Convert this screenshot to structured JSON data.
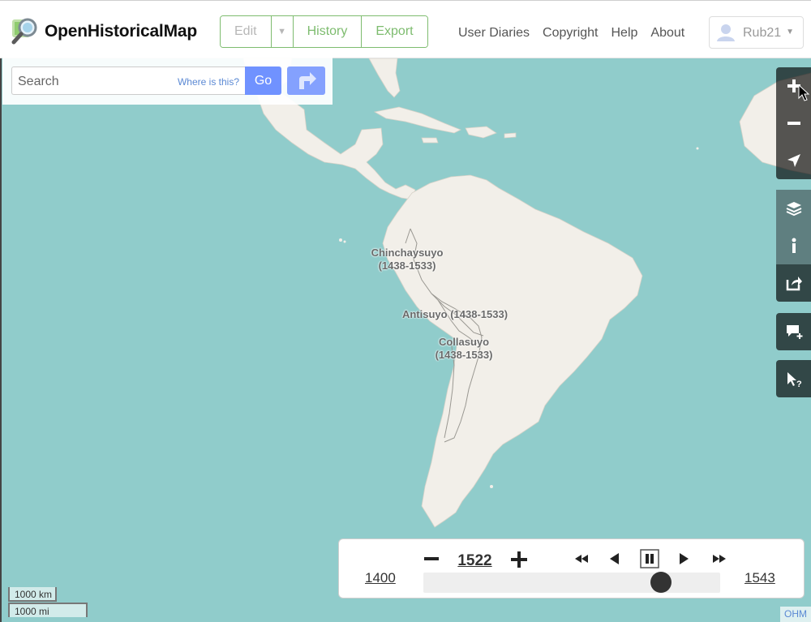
{
  "header": {
    "brand": "OpenHistoricalMap",
    "edit_label": "Edit",
    "history_label": "History",
    "export_label": "Export",
    "nav": [
      "User Diaries",
      "Copyright",
      "Help",
      "About"
    ],
    "user_name": "Rub21"
  },
  "search": {
    "placeholder": "Search",
    "where_label": "Where is this?",
    "go_label": "Go"
  },
  "map": {
    "labels": {
      "chinchaysuyo_name": "Chinchaysuyo",
      "chinchaysuyo_years": "(1438-1533)",
      "antisuyo": "Antisuyo (1438-1533)",
      "collasuyo_name": "Collasuyo",
      "collasuyo_years": "(1438-1533)"
    },
    "colors": {
      "water": "#90cccb",
      "land": "#f2efe9",
      "accent": "#7ebc6f",
      "button": "#7092ff"
    }
  },
  "controls": [
    "zoom-in",
    "zoom-out",
    "locate",
    "layers",
    "info",
    "share",
    "note",
    "query"
  ],
  "timeslider": {
    "year": "1522",
    "start": "1400",
    "end": "1543",
    "position": 0.8
  },
  "scale": {
    "km": "1000 km",
    "mi": "1000 mi"
  },
  "attribution": "OHM"
}
